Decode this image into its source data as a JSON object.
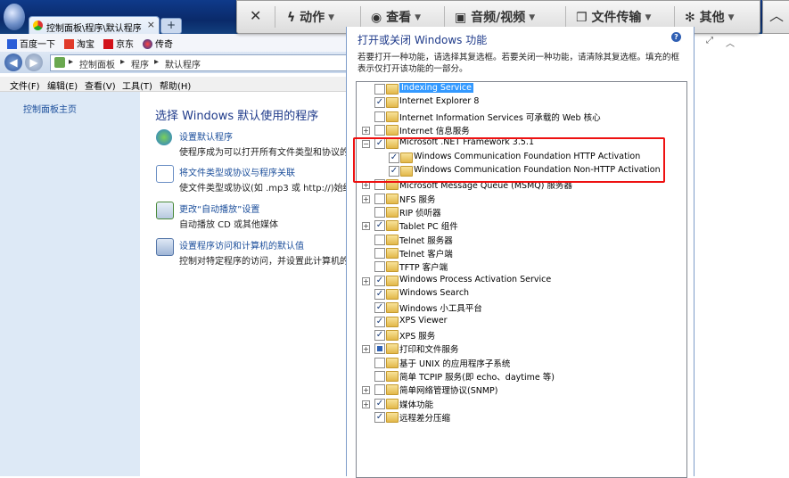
{
  "browser": {
    "tab_title": "控制面板\\程序\\默认程序",
    "new_tab": "+",
    "favorites": [
      "百度一下",
      "淘宝",
      "京东",
      "传奇"
    ],
    "breadcrumbs": [
      "控制面板",
      "程序",
      "默认程序"
    ],
    "menu": [
      "文件(F)",
      "编辑(E)",
      "查看(V)",
      "工具(T)",
      "帮助(H)"
    ]
  },
  "remote_toolbar": {
    "close": "✕",
    "items": [
      "动作",
      "查看",
      "音频/视频",
      "文件传输",
      "其他"
    ],
    "collapse": "︿"
  },
  "left_pane": {
    "home_link": "控制面板主页"
  },
  "content": {
    "title": "选择 Windows 默认使用的程序",
    "items": [
      {
        "link": "设置默认程序",
        "desc": "使程序成为可以打开所有文件类型和协议的默认"
      },
      {
        "link": "将文件类型或协议与程序关联",
        "desc": "使文件类型或协议(如 .mp3 或 http://)始终在"
      },
      {
        "link": "更改“自动播放”设置",
        "desc": "自动播放 CD 或其他媒体"
      },
      {
        "link": "设置程序访问和计算机的默认值",
        "desc": "控制对特定程序的访问，并设置此计算机的默认"
      }
    ]
  },
  "dialog": {
    "title": "打开或关闭 Windows 功能",
    "help": "?",
    "description": "若要打开一种功能，请选择其复选框。若要关闭一种功能，请清除其复选框。填充的框表示仅打开该功能的一部分。",
    "features": [
      {
        "label": "Indexing Service",
        "state": "unchecked",
        "expand": "",
        "indent": 0,
        "selected": true
      },
      {
        "label": "Internet Explorer 8",
        "state": "checked",
        "expand": "",
        "indent": 0
      },
      {
        "label": "Internet Information Services 可承载的 Web 核心",
        "state": "unchecked",
        "expand": "",
        "indent": 0
      },
      {
        "label": "Internet 信息服务",
        "state": "unchecked",
        "expand": "+",
        "indent": 0
      },
      {
        "label": "Microsoft .NET Framework 3.5.1",
        "state": "checked",
        "expand": "−",
        "indent": 0
      },
      {
        "label": "Windows Communication Foundation HTTP Activation",
        "state": "checked",
        "expand": "",
        "indent": 1
      },
      {
        "label": "Windows Communication Foundation Non-HTTP Activation",
        "state": "checked",
        "expand": "",
        "indent": 1
      },
      {
        "label": "Microsoft Message Queue (MSMQ) 服务器",
        "state": "unchecked",
        "expand": "+",
        "indent": 0
      },
      {
        "label": "NFS 服务",
        "state": "unchecked",
        "expand": "+",
        "indent": 0
      },
      {
        "label": "RIP 侦听器",
        "state": "unchecked",
        "expand": "",
        "indent": 0
      },
      {
        "label": "Tablet PC 组件",
        "state": "checked",
        "expand": "+",
        "indent": 0
      },
      {
        "label": "Telnet 服务器",
        "state": "unchecked",
        "expand": "",
        "indent": 0
      },
      {
        "label": "Telnet 客户端",
        "state": "unchecked",
        "expand": "",
        "indent": 0
      },
      {
        "label": "TFTP 客户端",
        "state": "unchecked",
        "expand": "",
        "indent": 0
      },
      {
        "label": "Windows Process Activation Service",
        "state": "checked",
        "expand": "+",
        "indent": 0
      },
      {
        "label": "Windows Search",
        "state": "checked",
        "expand": "",
        "indent": 0
      },
      {
        "label": "Windows 小工具平台",
        "state": "checked",
        "expand": "",
        "indent": 0
      },
      {
        "label": "XPS Viewer",
        "state": "checked",
        "expand": "",
        "indent": 0
      },
      {
        "label": "XPS 服务",
        "state": "checked",
        "expand": "",
        "indent": 0
      },
      {
        "label": "打印和文件服务",
        "state": "partial",
        "expand": "+",
        "indent": 0
      },
      {
        "label": "基于 UNIX 的应用程序子系统",
        "state": "unchecked",
        "expand": "",
        "indent": 0
      },
      {
        "label": "简单 TCPIP 服务(即 echo、daytime 等)",
        "state": "unchecked",
        "expand": "",
        "indent": 0
      },
      {
        "label": "简单网络管理协议(SNMP)",
        "state": "unchecked",
        "expand": "+",
        "indent": 0
      },
      {
        "label": "媒体功能",
        "state": "checked",
        "expand": "+",
        "indent": 0
      },
      {
        "label": "远程差分压缩",
        "state": "checked",
        "expand": "",
        "indent": 0
      }
    ]
  },
  "colors": {
    "highlight_box": "#ee1111",
    "selection": "#3399ff"
  }
}
